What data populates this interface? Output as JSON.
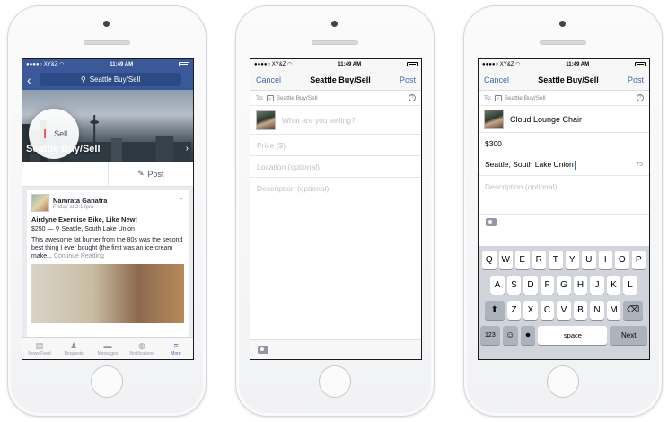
{
  "phone1": {
    "status": {
      "carrier": "●●●●○ XY&Z",
      "wifi": "◠",
      "time": "11:49 AM"
    },
    "search_text": "Seattle Buy/Sell",
    "group_title": "Seattle Buy/Sell",
    "sell_label": "Sell",
    "post_label": "Post",
    "post": {
      "author": "Namrata Ganatra",
      "time": "Friday at 2:18pm",
      "title": "Airdyne Exercise Bike, Like New!",
      "price_location": "$250 — ⚲ Seattle, South Lake Union",
      "body": "This awesome fat burner from the 80s was the second best thing I ever bought (the first was an ice-cream make...",
      "continue": "Continue Reading"
    },
    "tabs": [
      {
        "label": "News Feed",
        "icon": "▤"
      },
      {
        "label": "Requests",
        "icon": "♟"
      },
      {
        "label": "Messages",
        "icon": "▬"
      },
      {
        "label": "Notifications",
        "icon": "◍"
      },
      {
        "label": "More",
        "icon": "≡"
      }
    ]
  },
  "phone2": {
    "status": {
      "carrier": "●●●●○ XY&Z",
      "wifi": "◠",
      "time": "11:49 AM"
    },
    "cancel": "Cancel",
    "title": "Seattle Buy/Sell",
    "post": "Post",
    "to_label": "To:",
    "to_group": "Seattle Buy/Sell",
    "what_placeholder": "What are you selling?",
    "price_placeholder": "Price ($)",
    "location_placeholder": "Location (optional)",
    "description_placeholder": "Description (optional)"
  },
  "phone3": {
    "status": {
      "carrier": "●●●●○ XY&Z",
      "wifi": "◠",
      "time": "11:49 AM"
    },
    "cancel": "Cancel",
    "title": "Seattle Buy/Sell",
    "post": "Post",
    "to_label": "To:",
    "to_group": "Seattle Buy/Sell",
    "item_value": "Cloud Lounge Chair",
    "price_value": "$300",
    "location_value": "Seattle, South Lake Union",
    "char_count": "75",
    "description_placeholder": "Description (optional)",
    "keyboard": {
      "row1": [
        "Q",
        "W",
        "E",
        "R",
        "T",
        "Y",
        "U",
        "I",
        "O",
        "P"
      ],
      "row2": [
        "A",
        "S",
        "D",
        "F",
        "G",
        "H",
        "J",
        "K",
        "L"
      ],
      "row3": [
        "Z",
        "X",
        "C",
        "V",
        "B",
        "N",
        "M"
      ],
      "shift": "⬆",
      "delete": "⌫",
      "numbers": "123",
      "emoji": "☺",
      "mic": "⏺",
      "space": "space",
      "next": "Next"
    }
  },
  "colors": {
    "facebook_blue": "#3b5998",
    "link_blue": "#4267b2",
    "keyboard_bg": "#d1d5db"
  }
}
